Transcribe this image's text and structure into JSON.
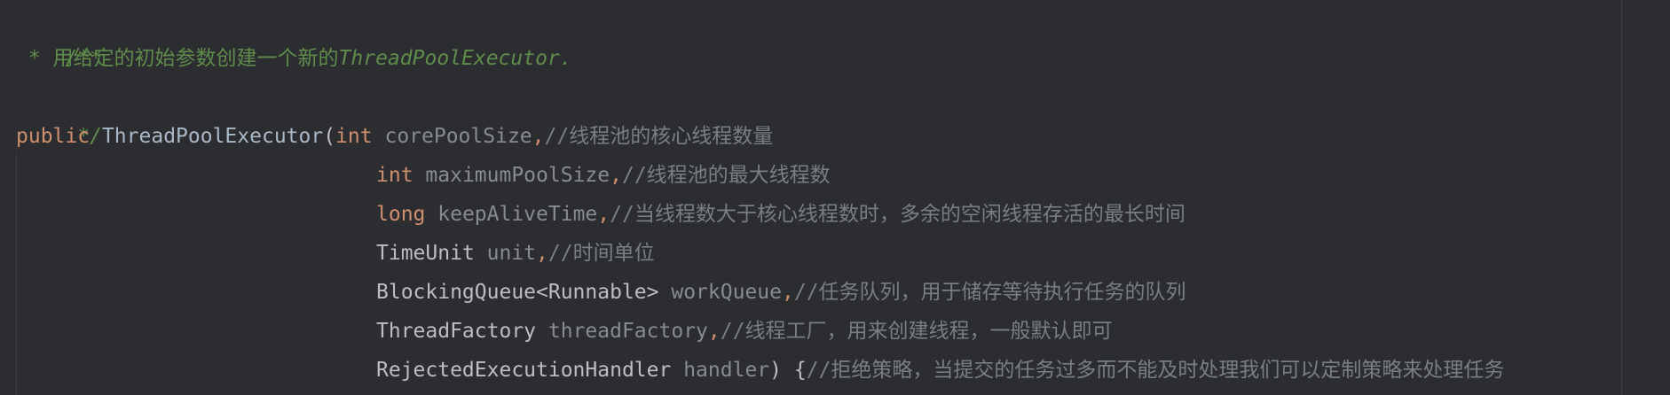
{
  "code": {
    "doc_open": "/**",
    "doc_line_prefix": " * ",
    "doc_line_text": "用给定的初始参数创建一个新的",
    "doc_line_ref": "ThreadPoolExecutor.",
    "doc_close": " */",
    "sig": {
      "modifier": "public",
      "name": "ThreadPoolExecutor",
      "open_paren": "("
    },
    "params": [
      {
        "type": "int",
        "type_is_keyword": true,
        "name": "corePoolSize",
        "comma": ",",
        "comment": "//线程池的核心线程数量"
      },
      {
        "type": "int",
        "type_is_keyword": true,
        "name": "maximumPoolSize",
        "comma": ",",
        "comment": "//线程池的最大线程数"
      },
      {
        "type": "long",
        "type_is_keyword": true,
        "name": "keepAliveTime",
        "comma": ",",
        "comment": "//当线程数大于核心线程数时，多余的空闲线程存活的最长时间"
      },
      {
        "type": "TimeUnit",
        "type_is_keyword": false,
        "name": "unit",
        "comma": ",",
        "comment": "//时间单位"
      },
      {
        "type": "BlockingQueue<Runnable>",
        "type_is_keyword": false,
        "name": "workQueue",
        "comma": ",",
        "comment": "//任务队列，用于储存等待执行任务的队列"
      },
      {
        "type": "ThreadFactory",
        "type_is_keyword": false,
        "name": "threadFactory",
        "comma": ",",
        "comment": "//线程工厂，用来创建线程，一般默认即可"
      },
      {
        "type": "RejectedExecutionHandler",
        "type_is_keyword": false,
        "name": "handler",
        "close": ") {",
        "comment": "//拒绝策略，当提交的任务过多而不能及时处理我们可以定制策略来处理任务"
      }
    ]
  },
  "colors": {
    "background": "#2b2d30",
    "keyword": "#cf8e6d",
    "doc_comment": "#5f8c4a",
    "line_comment": "#7a7e85",
    "parameter": "#888c8f",
    "type": "#bcbec4"
  }
}
